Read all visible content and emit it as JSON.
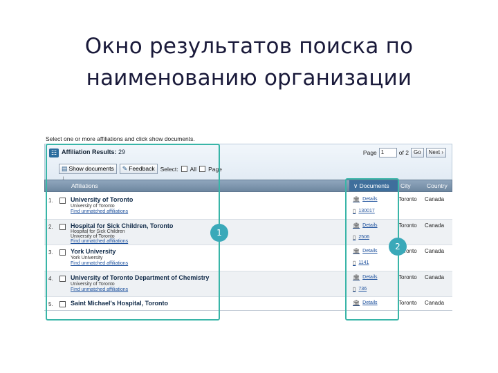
{
  "slide": {
    "title_line1": "Окно результатов поиска по",
    "title_line2": "наименованию организации"
  },
  "screenshot": {
    "instruction": "Select one or more affiliations and click show documents.",
    "results_label": "Affiliation Results:",
    "results_count": "29",
    "page_label": "Page",
    "page_value": "1",
    "page_of": "of 2",
    "go_label": "Go",
    "next_label": "Next",
    "show_documents_label": "Show documents",
    "feedback_label": "Feedback",
    "select_label": "Select:",
    "all_label": "All",
    "page_select_label": "Page",
    "columns": {
      "affiliations": "Affiliations",
      "documents": "Documents",
      "city": "City",
      "country": "Country"
    },
    "rows": [
      {
        "num": "1.",
        "name": "University of Toronto",
        "sub1": "University of Toronto",
        "sub2": "",
        "link": "Find unmatched affiliations",
        "details": "Details",
        "docs": "130017",
        "city": "Toronto",
        "country": "Canada"
      },
      {
        "num": "2.",
        "name": "Hospital for Sick Children, Toronto",
        "sub1": "Hospital for Sick Children",
        "sub2": "University of Toronto",
        "link": "Find unmatched affiliations",
        "details": "Details",
        "docs": "2506",
        "city": "Toronto",
        "country": "Canada"
      },
      {
        "num": "3.",
        "name": "York University",
        "sub1": "York University",
        "sub2": "",
        "link": "Find unmatched affiliations",
        "details": "Details",
        "docs": "1141",
        "city": "Toronto",
        "country": "Canada"
      },
      {
        "num": "4.",
        "name": "University of Toronto Department of Chemistry",
        "sub1": "University of Toronto",
        "sub2": "",
        "link": "Find unmatched affiliations",
        "details": "Details",
        "docs": "736",
        "city": "Toronto",
        "country": "Canada"
      },
      {
        "num": "5.",
        "name": "Saint Michael's Hospital, Toronto",
        "sub1": "",
        "sub2": "",
        "link": "",
        "details": "Details",
        "docs": "",
        "city": "Toronto",
        "country": "Canada"
      }
    ]
  },
  "callouts": {
    "one": "1",
    "two": "2"
  },
  "colors": {
    "highlight": "#39b5a8",
    "badge": "#3aa9b9",
    "header": "#6e87a0"
  }
}
